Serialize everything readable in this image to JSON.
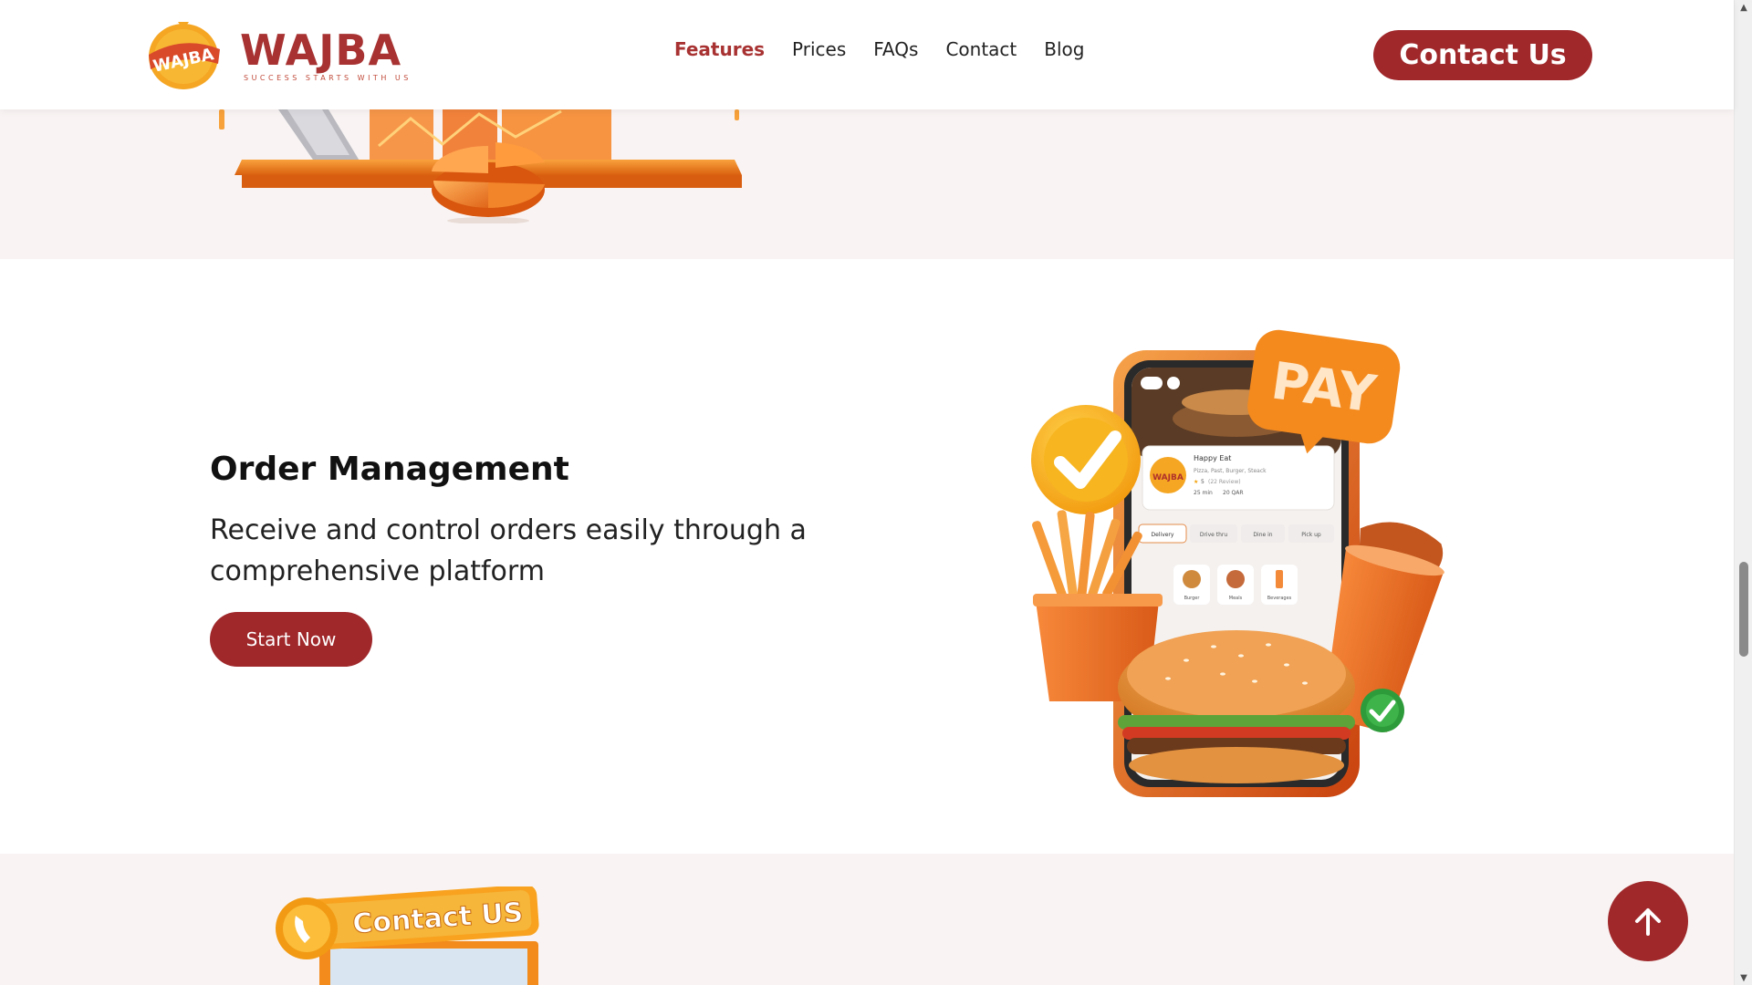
{
  "header": {
    "brand": "WAJBA",
    "tagline": "SUCCESS STARTS WITH US",
    "badge_text": "WAJBA",
    "nav": [
      {
        "label": "Features",
        "active": true
      },
      {
        "label": "Prices",
        "active": false
      },
      {
        "label": "FAQs",
        "active": false
      },
      {
        "label": "Contact",
        "active": false
      },
      {
        "label": "Blog",
        "active": false
      }
    ],
    "cta_label": "Contact Us"
  },
  "section_order": {
    "title": "Order Management",
    "description": "Receive and control orders easily through a comprehensive platform",
    "button_label": "Start Now",
    "illustration": {
      "pay_badge": "PAY",
      "app_restaurant": "Happy Eat",
      "app_cuisine": "Pizza, Past, Burger, Steack",
      "app_rating": "5",
      "app_reviews": "(22 Review)",
      "app_time": "25 min",
      "app_price": "20 QAR",
      "app_modes": [
        "Delivery",
        "Drive thru",
        "Dine in",
        "Pick up"
      ],
      "app_categories": [
        "Burger",
        "Meals",
        "Beverages"
      ]
    }
  },
  "section_contact": {
    "sign_text": "Contact US"
  },
  "icons": {
    "back_to_top": "arrow-up-icon",
    "scroll_up": "triangle-up-icon",
    "scroll_down": "triangle-down-icon"
  },
  "colors": {
    "brand": "#a0282b",
    "accent_orange": "#f28a1c",
    "section_bg": "#f9f4f3"
  }
}
